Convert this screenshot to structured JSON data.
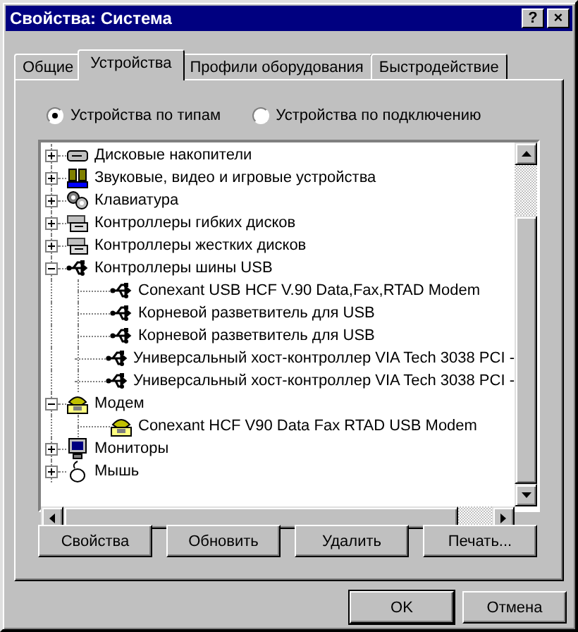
{
  "window": {
    "title": "Свойства: Система",
    "help_button": "?",
    "close_button": "×"
  },
  "tabs": [
    {
      "label": "Общие",
      "selected": false
    },
    {
      "label": "Устройства",
      "selected": true
    },
    {
      "label": "Профили оборудования",
      "selected": false
    },
    {
      "label": "Быстродействие",
      "selected": false
    }
  ],
  "view_options": [
    {
      "label": "Устройства по типам",
      "selected": true
    },
    {
      "label": "Устройства по подключению",
      "selected": false
    }
  ],
  "device_tree": [
    {
      "label": "Дисковые накопители",
      "kind": "disk",
      "expanded": false
    },
    {
      "label": "Звуковые, видео и игровые устройства",
      "kind": "sound",
      "expanded": false
    },
    {
      "label": "Клавиатура",
      "kind": "keyboard",
      "expanded": false
    },
    {
      "label": "Контроллеры гибких дисков",
      "kind": "controller",
      "expanded": false
    },
    {
      "label": "Контроллеры жестких дисков",
      "kind": "controller",
      "expanded": false
    },
    {
      "label": "Контроллеры шины USB",
      "kind": "usb",
      "expanded": true,
      "children": [
        {
          "label": "Conexant USB HCF V.90 Data,Fax,RTAD Modem",
          "kind": "usb"
        },
        {
          "label": "Корневой разветвитель для USB",
          "kind": "usb"
        },
        {
          "label": "Корневой разветвитель для USB",
          "kind": "usb"
        },
        {
          "label": "Универсальный хост-контроллер VIA Tech 3038 PCI -",
          "kind": "usb"
        },
        {
          "label": "Универсальный хост-контроллер VIA Tech 3038 PCI -",
          "kind": "usb"
        }
      ]
    },
    {
      "label": "Модем",
      "kind": "modem",
      "expanded": true,
      "children": [
        {
          "label": "Conexant HCF V90 Data Fax RTAD USB Modem",
          "kind": "modem"
        }
      ]
    },
    {
      "label": "Мониторы",
      "kind": "monitor",
      "expanded": false
    },
    {
      "label": "Мышь",
      "kind": "mouse",
      "expanded": false
    }
  ],
  "device_buttons": [
    "Свойства",
    "Обновить",
    "Удалить",
    "Печать..."
  ],
  "dialog_buttons": [
    {
      "label": "OK",
      "default": true
    },
    {
      "label": "Отмена",
      "default": false
    }
  ]
}
